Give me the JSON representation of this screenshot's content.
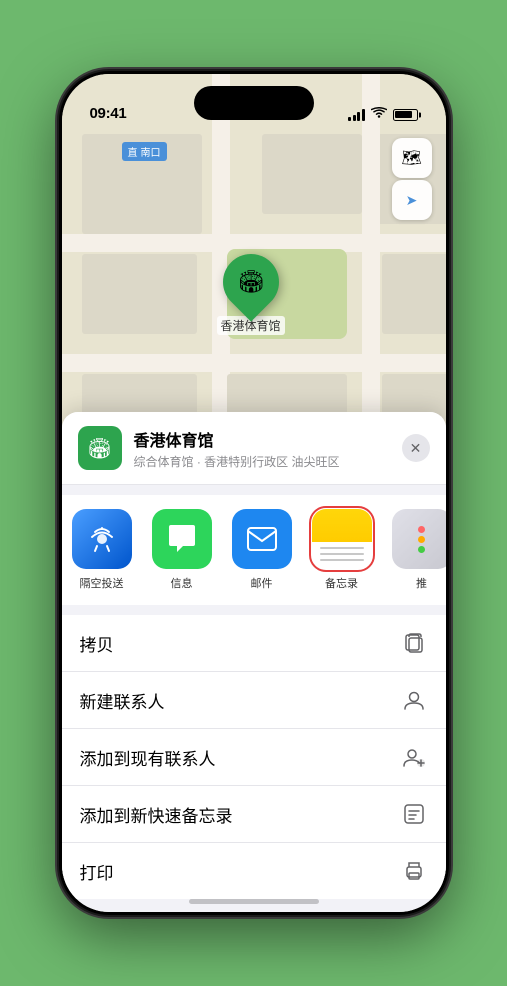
{
  "status": {
    "time": "09:41",
    "location_arrow": "▶"
  },
  "map": {
    "label": "南口",
    "label_prefix": "直"
  },
  "map_controls": {
    "layers_icon": "🗺",
    "location_icon": "➤"
  },
  "location": {
    "name": "香港体育馆",
    "subtitle": "综合体育馆 · 香港特别行政区 油尖旺区",
    "marker_label": "香港体育馆"
  },
  "share_items": [
    {
      "id": "airdrop",
      "label": "隔空投送",
      "type": "airdrop"
    },
    {
      "id": "messages",
      "label": "信息",
      "type": "messages"
    },
    {
      "id": "mail",
      "label": "邮件",
      "type": "mail"
    },
    {
      "id": "notes",
      "label": "备忘录",
      "type": "notes"
    },
    {
      "id": "more",
      "label": "推",
      "type": "more"
    }
  ],
  "actions": [
    {
      "id": "copy",
      "label": "拷贝",
      "icon": "copy"
    },
    {
      "id": "new-contact",
      "label": "新建联系人",
      "icon": "person"
    },
    {
      "id": "add-existing",
      "label": "添加到现有联系人",
      "icon": "person-add"
    },
    {
      "id": "add-notes",
      "label": "添加到新快速备忘录",
      "icon": "notes"
    },
    {
      "id": "print",
      "label": "打印",
      "icon": "print"
    }
  ]
}
